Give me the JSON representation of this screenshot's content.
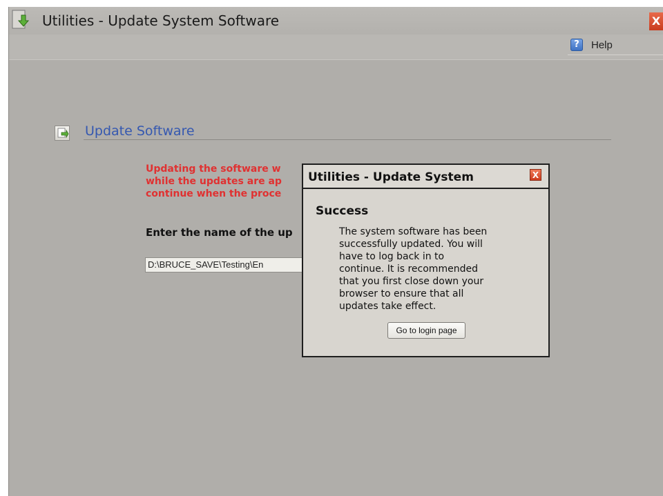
{
  "window": {
    "title": "Utilities - Update System Software",
    "close_label": "X",
    "help_label": "Help",
    "help_icon_glyph": "?"
  },
  "section": {
    "title": "Update Software"
  },
  "page": {
    "warning_lines": [
      "Updating the software w",
      "while the updates are ap",
      "continue when the proce"
    ],
    "file_label": "Enter the name of the up",
    "file_value": "D:\\BRUCE_SAVE\\Testing\\En"
  },
  "dialog": {
    "title": "Utilities - Update System",
    "close_label": "X",
    "heading": "Success",
    "message_lines": [
      "The system software has been",
      "successfully updated. You will",
      "have to log back in to",
      "continue. It is recommended",
      "that you first close down your",
      "browser to ensure that all",
      "updates take effect."
    ],
    "button_label": "Go to login page"
  },
  "colors": {
    "background": "#b0aeaa",
    "warning": "#e03131",
    "link_blue": "#3558b0",
    "close_red": "#cf3d1f"
  },
  "icons": {
    "app": "update-download-icon",
    "help": "help-question-icon",
    "section": "update-document-icon",
    "close": "close-icon"
  }
}
